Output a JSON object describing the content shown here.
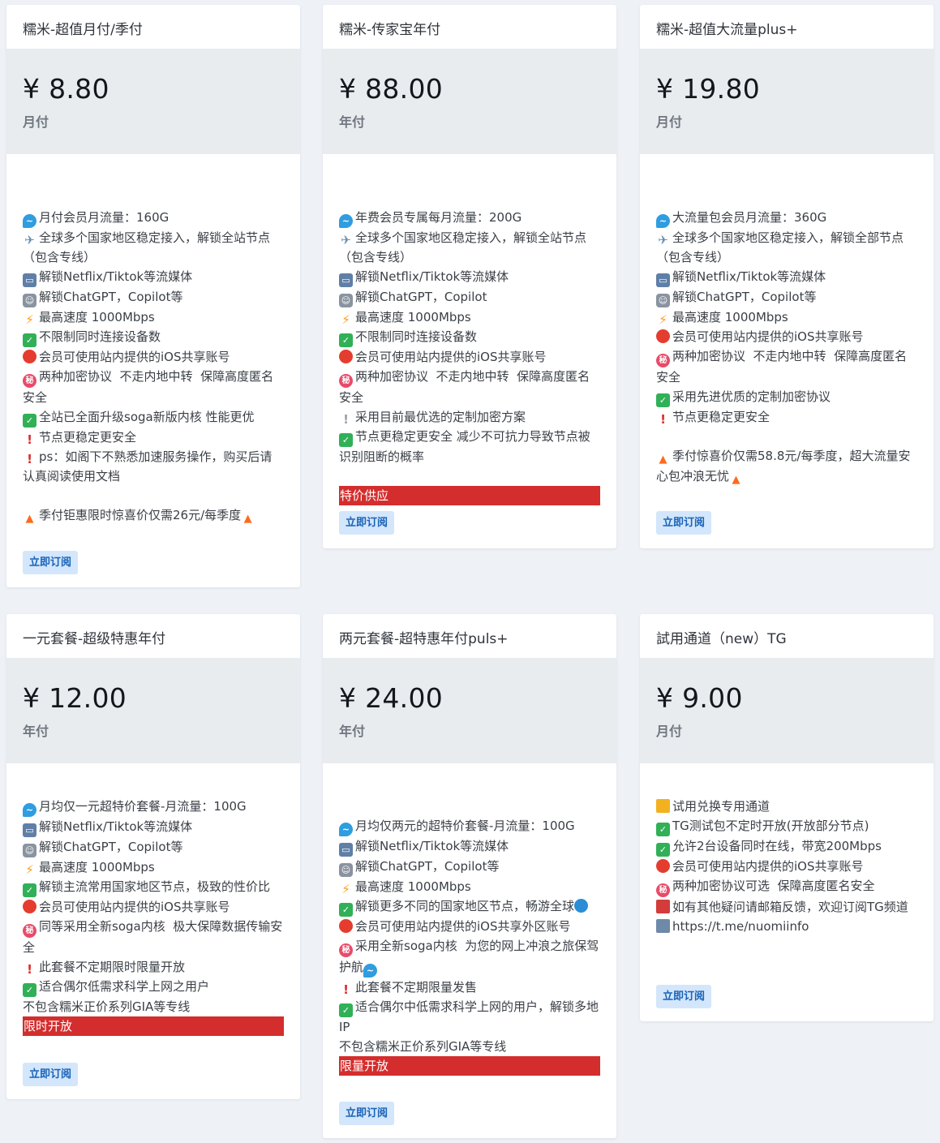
{
  "currency": "¥",
  "subscribe_label": "立即订阅",
  "plans": [
    {
      "title": "糯米-超值月付/季付",
      "price": "¥ 8.80",
      "period": "月付",
      "features": [
        {
          "icon": "wave-icon",
          "text": "月付会员月流量：160G"
        },
        {
          "icon": "airplane-icon",
          "text": "全球多个国家地区稳定接入，解锁全站节点（包含专线）"
        },
        {
          "icon": "tv-icon",
          "text": "解锁Netflix/Tiktok等流媒体"
        },
        {
          "icon": "robot-icon",
          "text": "解锁ChatGPT，Copilot等"
        },
        {
          "icon": "lightning-icon",
          "text": "最高速度 1000Mbps"
        },
        {
          "icon": "check-icon",
          "text": "不限制同时连接设备数"
        },
        {
          "icon": "apple-icon",
          "text": "会员可使用站内提供的iOS共享账号"
        },
        {
          "icon": "secret-icon",
          "text": "两种加密协议  不走内地中转  保障高度匿名安全"
        },
        {
          "icon": "check-icon",
          "text": "全站已全面升级soga新版内核 性能更优"
        },
        {
          "icon": "exclamation-icon",
          "text": "节点更稳定更安全"
        },
        {
          "icon": "exclamation-icon",
          "text": "ps：如阁下不熟悉加速服务操作，购买后请认真阅读使用文档"
        },
        {
          "icon": "",
          "text": ""
        },
        {
          "icon": "fire-icon",
          "text": "季付钜惠限时惊喜价仅需26元/每季度",
          "icon_after": "fire-icon"
        }
      ],
      "banner": ""
    },
    {
      "title": "糯米-传家宝年付",
      "price": "¥ 88.00",
      "period": "年付",
      "features": [
        {
          "icon": "wave-icon",
          "text": "年费会员专属每月流量：200G"
        },
        {
          "icon": "airplane-icon",
          "text": "全球多个国家地区稳定接入，解锁全站节点（包含专线）"
        },
        {
          "icon": "tv-icon",
          "text": "解锁Netflix/Tiktok等流媒体"
        },
        {
          "icon": "robot-icon",
          "text": "解锁ChatGPT，Copilot"
        },
        {
          "icon": "lightning-icon",
          "text": "最高速度 1000Mbps"
        },
        {
          "icon": "check-icon",
          "text": "不限制同时连接设备数"
        },
        {
          "icon": "apple-icon",
          "text": "会员可使用站内提供的iOS共享账号"
        },
        {
          "icon": "secret-icon",
          "text": "两种加密协议  不走内地中转  保障高度匿名安全"
        },
        {
          "icon": "grey-exclamation-icon",
          "text": "采用目前最优选的定制加密方案"
        },
        {
          "icon": "check-icon",
          "text": "节点更稳定更安全 减少不可抗力导致节点被识别阻断的概率"
        }
      ],
      "banner": "特价供应"
    },
    {
      "title": "糯米-超值大流量plus+",
      "price": "¥ 19.80",
      "period": "月付",
      "features": [
        {
          "icon": "wave-icon",
          "text": "大流量包会员月流量：360G"
        },
        {
          "icon": "airplane-icon",
          "text": "全球多个国家地区稳定接入，解锁全部节点（包含专线）"
        },
        {
          "icon": "tv-icon",
          "text": "解锁Netflix/Tiktok等流媒体"
        },
        {
          "icon": "robot-icon",
          "text": "解锁ChatGPT，Copilot等"
        },
        {
          "icon": "lightning-icon",
          "text": "最高速度 1000Mbps"
        },
        {
          "icon": "apple-icon",
          "text": "会员可使用站内提供的iOS共享账号"
        },
        {
          "icon": "secret-icon",
          "text": "两种加密协议  不走内地中转  保障高度匿名安全"
        },
        {
          "icon": "check-icon",
          "text": "采用先进优质的定制加密协议"
        },
        {
          "icon": "exclamation-icon",
          "text": "节点更稳定更安全"
        },
        {
          "icon": "",
          "text": ""
        },
        {
          "icon": "fire-icon",
          "text": "季付惊喜价仅需58.8元/每季度，超大流量安心包冲浪无忧",
          "icon_after": "fire-icon"
        }
      ],
      "banner": ""
    },
    {
      "title": "一元套餐-超级特惠年付",
      "price": "¥ 12.00",
      "period": "年付",
      "features": [
        {
          "icon": "wave-icon",
          "text": "月均仅一元超特价套餐-月流量：100G"
        },
        {
          "icon": "tv-icon",
          "text": "解锁Netflix/Tiktok等流媒体"
        },
        {
          "icon": "robot-icon",
          "text": "解锁ChatGPT，Copilot等"
        },
        {
          "icon": "lightning-icon",
          "text": "最高速度 1000Mbps"
        },
        {
          "icon": "check-icon",
          "text": "解锁主流常用国家地区节点，极致的性价比"
        },
        {
          "icon": "apple-icon",
          "text": "会员可使用站内提供的iOS共享账号"
        },
        {
          "icon": "secret-icon",
          "text": "同等采用全新soga内核  极大保障数据传输安全"
        },
        {
          "icon": "exclamation-icon",
          "text": "此套餐不定期限时限量开放"
        },
        {
          "icon": "check-icon",
          "text": "适合偶尔低需求科学上网之用户"
        },
        {
          "icon": "",
          "text": "不包含糯米正价系列GIA等专线"
        }
      ],
      "banner": "限时开放"
    },
    {
      "title": "两元套餐-超特惠年付puls+",
      "price": "¥ 24.00",
      "period": "年付",
      "features": [
        {
          "icon": "wave-icon",
          "text": "月均仅两元的超特价套餐-月流量：100G"
        },
        {
          "icon": "tv-icon",
          "text": "解锁Netflix/Tiktok等流媒体"
        },
        {
          "icon": "robot-icon",
          "text": "解锁ChatGPT，Copilot等"
        },
        {
          "icon": "lightning-icon",
          "text": "最高速度 1000Mbps"
        },
        {
          "icon": "check-icon",
          "text": "解锁更多不同的国家地区节点，畅游全球",
          "icon_after": "globe-icon"
        },
        {
          "icon": "apple-icon",
          "text": "会员可使用站内提供的iOS共享外区账号"
        },
        {
          "icon": "secret-icon",
          "text": "采用全新soga内核  为您的网上冲浪之旅保驾护航",
          "icon_after": "wave-icon"
        },
        {
          "icon": "exclamation-icon",
          "text": "此套餐不定期限量发售"
        },
        {
          "icon": "check-icon",
          "text": "适合偶尔中低需求科学上网的用户，解锁多地IP"
        },
        {
          "icon": "",
          "text": "不包含糯米正价系列GIA等专线"
        }
      ],
      "banner": "限量开放"
    },
    {
      "title": "試用通道（new）TG",
      "price": "¥ 9.00",
      "period": "月付",
      "features": [
        {
          "icon": "ticket-icon",
          "text": "试用兑换专用通道"
        },
        {
          "icon": "check-icon",
          "text": "TG测试包不定时开放(开放部分节点)"
        },
        {
          "icon": "check-icon",
          "text": "允许2台设备同时在线，带宽200Mbps"
        },
        {
          "icon": "apple-icon",
          "text": "会员可使用站内提供的iOS共享账号"
        },
        {
          "icon": "secret-icon",
          "text": "两种加密协议可选  保障高度匿名安全"
        },
        {
          "icon": "mailbox-icon",
          "text": "如有其他疑问请邮箱反馈，欢迎订阅TG频道"
        },
        {
          "icon": "laptop-icon",
          "text": "https://t.me/nuomiinfo"
        }
      ],
      "banner": ""
    }
  ]
}
